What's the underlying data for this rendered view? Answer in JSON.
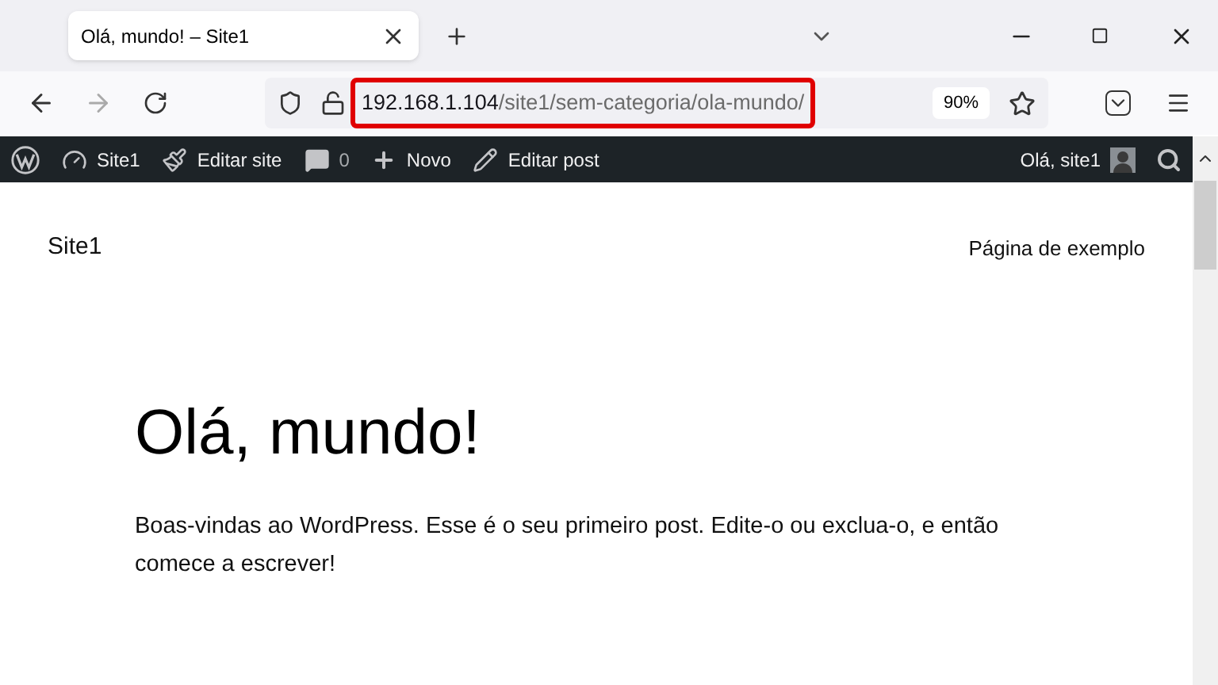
{
  "tab": {
    "title": "Olá, mundo! – Site1",
    "selected": true
  },
  "address_bar": {
    "host": "192.168.1.104",
    "path": "/site1/sem-categoria/ola-mundo/",
    "highlighted": true,
    "zoom": "90%"
  },
  "admin_bar": {
    "items": [
      {
        "kind": "site",
        "label": "Site1"
      },
      {
        "kind": "customize",
        "label": "Editar site"
      },
      {
        "kind": "comments",
        "label": "0"
      },
      {
        "kind": "new",
        "label": "Novo"
      },
      {
        "kind": "edit",
        "label": "Editar post"
      }
    ],
    "greeting": "Olá, site1"
  },
  "site": {
    "title": "Site1",
    "menu": [
      "Página de exemplo"
    ]
  },
  "post": {
    "title": "Olá, mundo!",
    "body": "Boas-vindas ao WordPress. Esse é o seu primeiro post. Edite-o ou exclua-o, e então comece a escrever!"
  }
}
